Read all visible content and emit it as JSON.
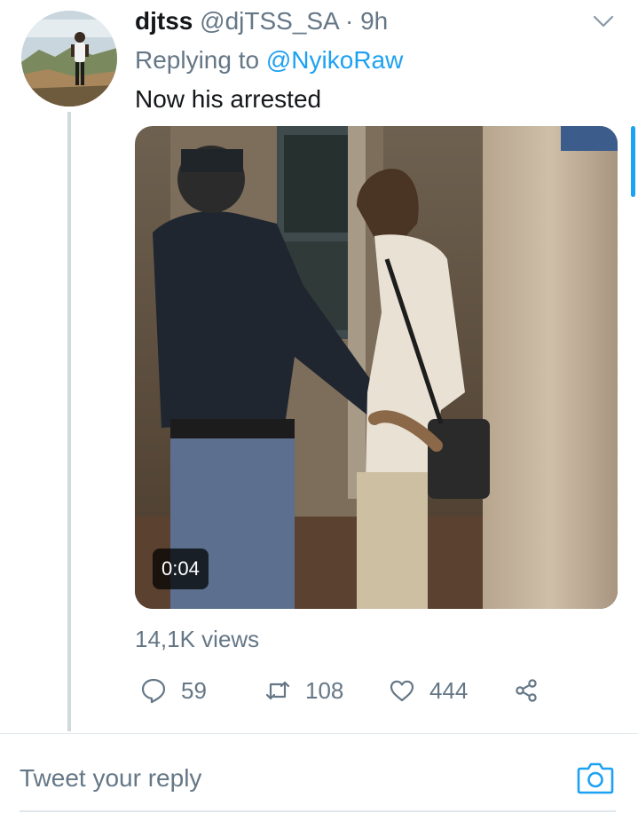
{
  "tweet": {
    "display_name": "djtss",
    "handle": "@djTSS_SA",
    "separator": "·",
    "time": "9h",
    "replying_to_prefix": "Replying to",
    "replying_to_handle": "@NyikoRaw",
    "text": "Now his arrested",
    "media": {
      "type": "video",
      "duration": "0:04"
    },
    "views": "14,1K views",
    "actions": {
      "replies": "59",
      "retweets": "108",
      "likes": "444"
    }
  },
  "composer": {
    "placeholder": "Tweet your reply"
  },
  "icons": {
    "more": "chevron-down-icon",
    "reply": "comment-icon",
    "retweet": "retweet-icon",
    "like": "heart-icon",
    "share": "share-icon",
    "camera": "camera-icon"
  },
  "colors": {
    "accent": "#1da1f2",
    "secondary_text": "#657786",
    "primary_text": "#14171a",
    "thread_line": "#cfd9de"
  }
}
